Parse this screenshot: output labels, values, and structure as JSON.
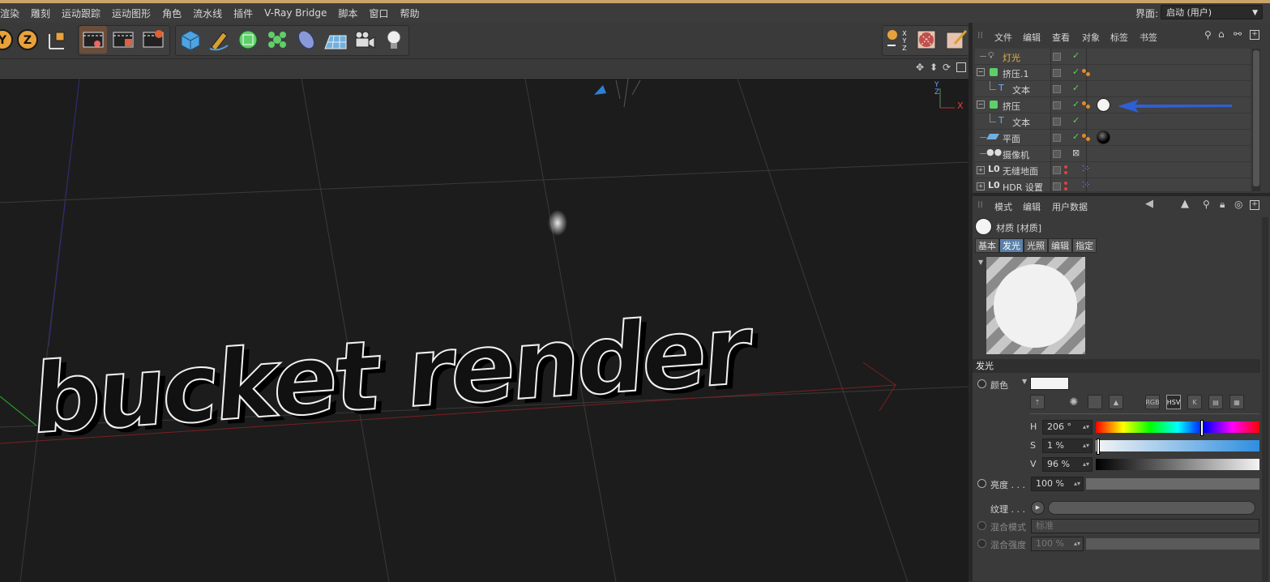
{
  "menu": {
    "items": [
      "渲染",
      "雕刻",
      "运动跟踪",
      "运动图形",
      "角色",
      "流水线",
      "插件",
      "V-Ray Bridge",
      "脚本",
      "窗口",
      "帮助"
    ],
    "layout_label": "界面:",
    "layout_value": "启动 (用户)"
  },
  "toolbar": {
    "axis_y": "Y",
    "axis_z": "Z"
  },
  "viewport": {
    "text": "bucket render",
    "axis_labels": [
      "Y",
      "Z",
      "X"
    ]
  },
  "objects": {
    "header_menu": [
      "文件",
      "编辑",
      "查看",
      "对象",
      "标签",
      "书签"
    ],
    "rows": [
      {
        "name": "灯光",
        "highlight": true
      },
      {
        "name": "挤压.1"
      },
      {
        "name": "文本"
      },
      {
        "name": "挤压"
      },
      {
        "name": "文本"
      },
      {
        "name": "平面"
      },
      {
        "name": "摄像机"
      },
      {
        "name": "无缝地面"
      },
      {
        "name": "HDR 设置"
      }
    ]
  },
  "attributes": {
    "header_menu": [
      "模式",
      "编辑",
      "用户数据"
    ],
    "material_title": "材质 [材质]",
    "tabs": [
      "基本",
      "发光",
      "光照",
      "编辑",
      "指定"
    ],
    "active_tab": "发光",
    "section": "发光",
    "color_label": "颜色",
    "color_value": "#f4f4f4",
    "mode_buttons": [
      "RGB",
      "HSV",
      "K"
    ],
    "h_label": "H",
    "h_value": "206 °",
    "s_label": "S",
    "s_value": "1 %",
    "v_label": "V",
    "v_value": "96 %",
    "brightness_label": "亮度 . . .",
    "brightness_value": "100 %",
    "texture_label": "纹理 . . .",
    "blend_mode_label": "混合模式",
    "blend_mode_value": "标准",
    "blend_strength_label": "混合强度",
    "blend_strength_value": "100 %"
  },
  "colors": {
    "accent_blue": "#2f5fd6",
    "highlight_text": "#e8b14a",
    "check_green": "#5fd15f",
    "tab_active": "#5b7fa6"
  }
}
